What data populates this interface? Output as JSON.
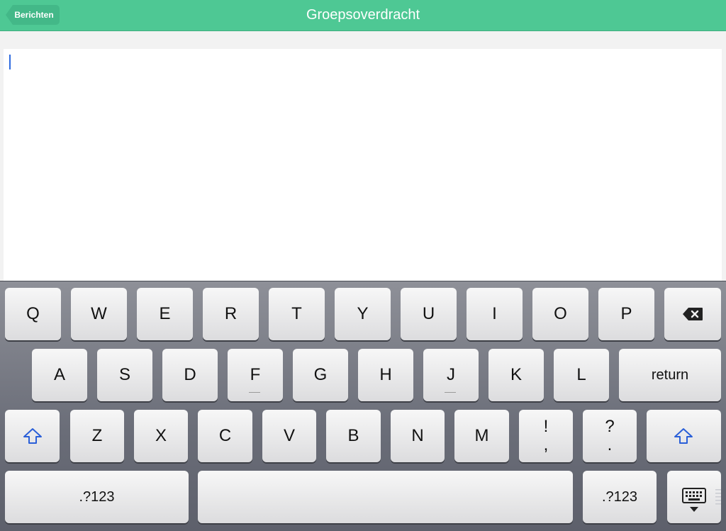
{
  "navbar": {
    "back_label": "Berichten",
    "title": "Groepsoverdracht"
  },
  "text_area": {
    "value": ""
  },
  "keyboard": {
    "row1": [
      "Q",
      "W",
      "E",
      "R",
      "T",
      "Y",
      "U",
      "I",
      "O",
      "P"
    ],
    "row2": [
      "A",
      "S",
      "D",
      "F",
      "G",
      "H",
      "J",
      "K",
      "L"
    ],
    "return_label": "return",
    "row3": [
      "Z",
      "X",
      "C",
      "V",
      "B",
      "N",
      "M"
    ],
    "punct1": {
      "top": "!",
      "bottom": ","
    },
    "punct2": {
      "top": "?",
      "bottom": "."
    },
    "numbers_left": ".?123",
    "numbers_right": ".?123",
    "icons": {
      "delete": "backspace-icon",
      "shift": "shift-icon",
      "dismiss": "keyboard-dismiss-icon"
    },
    "accent_color": "#2a5fd8"
  }
}
